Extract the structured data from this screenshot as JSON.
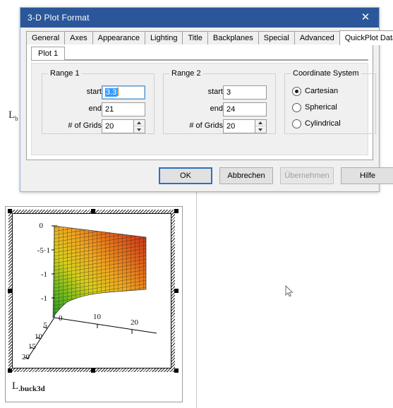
{
  "window": {
    "title": "3-D Plot Format",
    "close_icon": "close-icon"
  },
  "tabs": [
    {
      "label": "General",
      "active": false
    },
    {
      "label": "Axes",
      "active": false
    },
    {
      "label": "Appearance",
      "active": false
    },
    {
      "label": "Lighting",
      "active": false
    },
    {
      "label": "Title",
      "active": false
    },
    {
      "label": "Backplanes",
      "active": false
    },
    {
      "label": "Special",
      "active": false
    },
    {
      "label": "Advanced",
      "active": false
    },
    {
      "label": "QuickPlot Data",
      "active": true
    }
  ],
  "subtabs": [
    {
      "label": "Plot 1",
      "active": true
    }
  ],
  "range1": {
    "legend": "Range 1",
    "start_label": "start",
    "start_value": "3.3",
    "start_selected": true,
    "end_label": "end",
    "end_value": "21",
    "grids_label": "# of Grids",
    "grids_value": "20"
  },
  "range2": {
    "legend": "Range 2",
    "start_label": "start",
    "start_value": "3",
    "end_label": "end",
    "end_value": "24",
    "grids_label": "# of Grids",
    "grids_value": "20"
  },
  "coordinate_system": {
    "legend": "Coordinate System",
    "options": [
      {
        "label": "Cartesian",
        "selected": true
      },
      {
        "label": "Spherical",
        "selected": false
      },
      {
        "label": "Cylindrical",
        "selected": false
      }
    ]
  },
  "buttons": {
    "ok": "OK",
    "cancel": "Abbrechen",
    "apply": "Übernehmen",
    "apply_disabled": true,
    "help": "Hilfe"
  },
  "document": {
    "behind_label_base": "L",
    "behind_label_sub": "b",
    "plot_label_base": "L",
    "plot_label_sub": ".buck3d"
  },
  "chart_data": {
    "type": "surface",
    "title": "",
    "xlabel": "",
    "ylabel": "",
    "zlabel": "",
    "x_ticks": [
      "10",
      "20"
    ],
    "y_ticks": [
      "5",
      "10",
      "15",
      "20"
    ],
    "z_ticks": [
      "0",
      "-5·1",
      "-1",
      "-1"
    ],
    "z_origin_tick": "0",
    "xlim": [
      3.3,
      21
    ],
    "ylim": [
      3,
      24
    ],
    "grids_x": 20,
    "grids_y": 20,
    "colormap": [
      "#1f9e23",
      "#8fc41f",
      "#e8d41e",
      "#f0a020",
      "#e06018",
      "#c4241c"
    ],
    "grid": true,
    "legend": "none",
    "selected": true
  }
}
